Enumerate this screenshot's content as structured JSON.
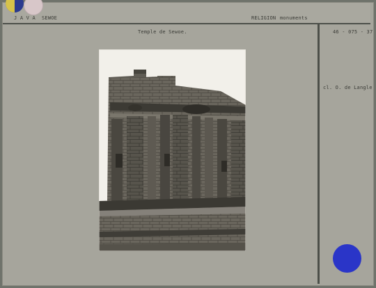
{
  "header": {
    "country": "J A V A",
    "site": "SEWOE",
    "category": "RELIGION",
    "subcategory": "monuments"
  },
  "caption": "Temple de Sewoe.",
  "reference": "46 - 075 - 37",
  "credit": "cl. O. de Langle",
  "photo": {
    "subject": "stone temple wall ruins"
  },
  "colors": {
    "card": "#a6a59c",
    "frame": "#6f736b",
    "rule": "#4c4f49",
    "stamp": "#2a35c8"
  }
}
